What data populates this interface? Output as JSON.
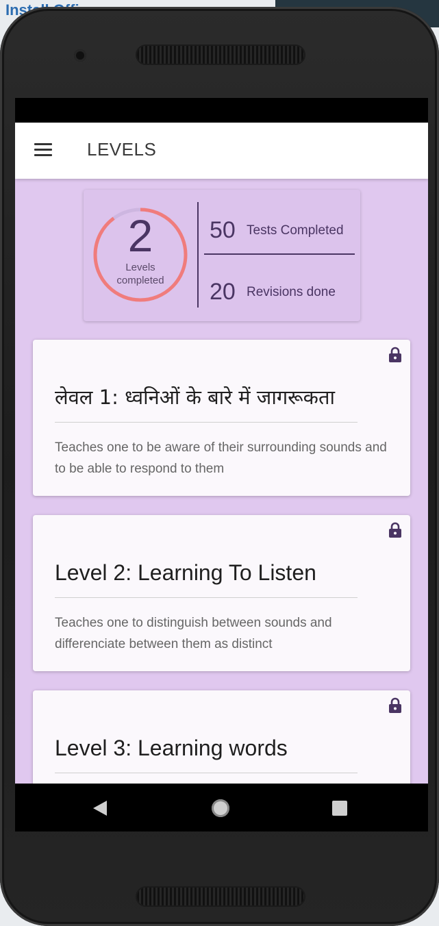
{
  "background": {
    "peek_text": "Install Offi"
  },
  "colors": {
    "accent_ring": "#f07c7c",
    "ring_track": "#cdb6e0",
    "content_background": "#e0c8ef",
    "primary_text": "#4a3563"
  },
  "appbar": {
    "title": "LEVELS",
    "menu_icon": "hamburger-menu-icon"
  },
  "stats": {
    "levels_completed": "2",
    "levels_label_line1": "Levels",
    "levels_label_line2": "completed",
    "tests_count": "50",
    "tests_label": "Tests Completed",
    "revisions_count": "20",
    "revisions_label": "Revisions done"
  },
  "levels": [
    {
      "title": "लेवल 1: ध्वनिओं के बारे में जागरूकता",
      "description": "Teaches one to be aware of their surrounding sounds and to be able to respond to them",
      "locked": true,
      "icon": "lock-icon"
    },
    {
      "title": "Level 2: Learning To Listen",
      "description": "Teaches one to distinguish between sounds and differenciate between them as distinct",
      "locked": true,
      "icon": "lock-icon"
    },
    {
      "title": "Level 3: Learning words",
      "description": "",
      "locked": true,
      "icon": "lock-icon"
    }
  ],
  "navbar": {
    "back_icon": "back-triangle-icon",
    "home_icon": "home-circle-icon",
    "recents_icon": "recents-square-icon"
  }
}
